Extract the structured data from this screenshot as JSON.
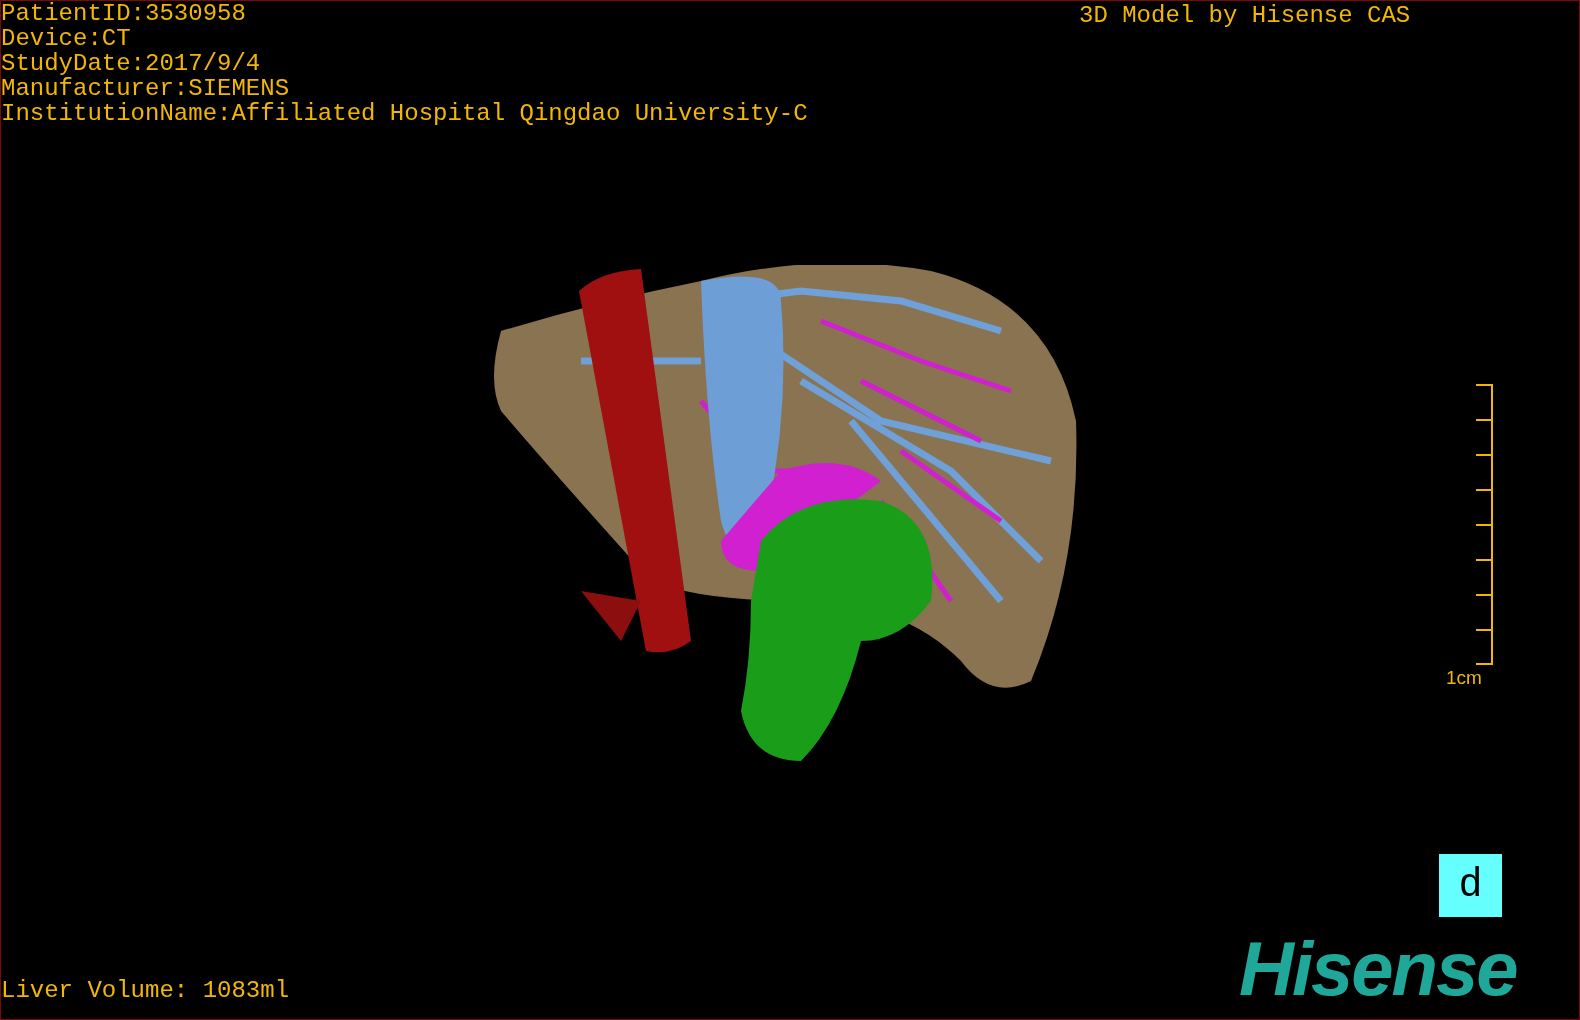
{
  "patient_info": [
    "PatientID:3530958",
    "Device:CT",
    "StudyDate:2017/9/4",
    "Manufacturer:SIEMENS",
    "InstitutionName:Affiliated Hospital Qingdao University-C"
  ],
  "model_credit": "3D Model by Hisense CAS",
  "scale_bar": {
    "label": "1cm"
  },
  "orientation_label": "d",
  "liver_volume": "Liver Volume: 1083ml",
  "logo": "Hisense"
}
